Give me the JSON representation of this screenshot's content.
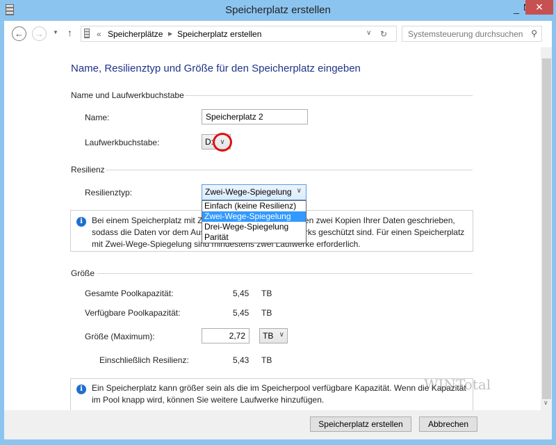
{
  "window": {
    "title": "Speicherplatz erstellen"
  },
  "nav": {
    "breadcrumb": [
      "Speicherplätze",
      "Speicherplatz erstellen"
    ],
    "search_placeholder": "Systemsteuerung durchsuchen"
  },
  "heading": "Name, Resilienztyp und Größe für den Speicherplatz eingeben",
  "section_name": {
    "title": "Name und Laufwerkbuchstabe",
    "name_label": "Name:",
    "name_value": "Speicherplatz 2",
    "drive_label": "Laufwerkbuchstabe:",
    "drive_value": "D:"
  },
  "section_res": {
    "title": "Resilienz",
    "type_label": "Resilienztyp:",
    "type_value": "Zwei-Wege-Spiegelung",
    "options": [
      "Einfach (keine Resilienz)",
      "Zwei-Wege-Spiegelung",
      "Drei-Wege-Spiegelung",
      "Parität"
    ],
    "info": "Bei einem Speicherplatz mit Zwei-Wege-Spiegelung werden zwei Kopien Ihrer Daten geschrieben, sodass die Daten vor dem Ausfall eines einzelnen Laufwerks geschützt sind. Für einen Speicherplatz mit Zwei-Wege-Spiegelung sind mindestens zwei Laufwerke erforderlich."
  },
  "section_size": {
    "title": "Größe",
    "total_label": "Gesamte Poolkapazität:",
    "total_value": "5,45",
    "total_unit": "TB",
    "avail_label": "Verfügbare Poolkapazität:",
    "avail_value": "5,45",
    "avail_unit": "TB",
    "size_label": "Größe (Maximum):",
    "size_value": "2,72",
    "size_unit": "TB",
    "incl_label": "Einschließlich Resilienz:",
    "incl_value": "5,43",
    "incl_unit": "TB",
    "info": "Ein Speicherplatz kann größer sein als die im Speicherpool verfügbare Kapazität. Wenn die Kapazität im Pool knapp wird, können Sie weitere Laufwerke hinzufügen."
  },
  "buttons": {
    "create": "Speicherplatz erstellen",
    "cancel": "Abbrechen"
  },
  "watermark": "WINTotal"
}
